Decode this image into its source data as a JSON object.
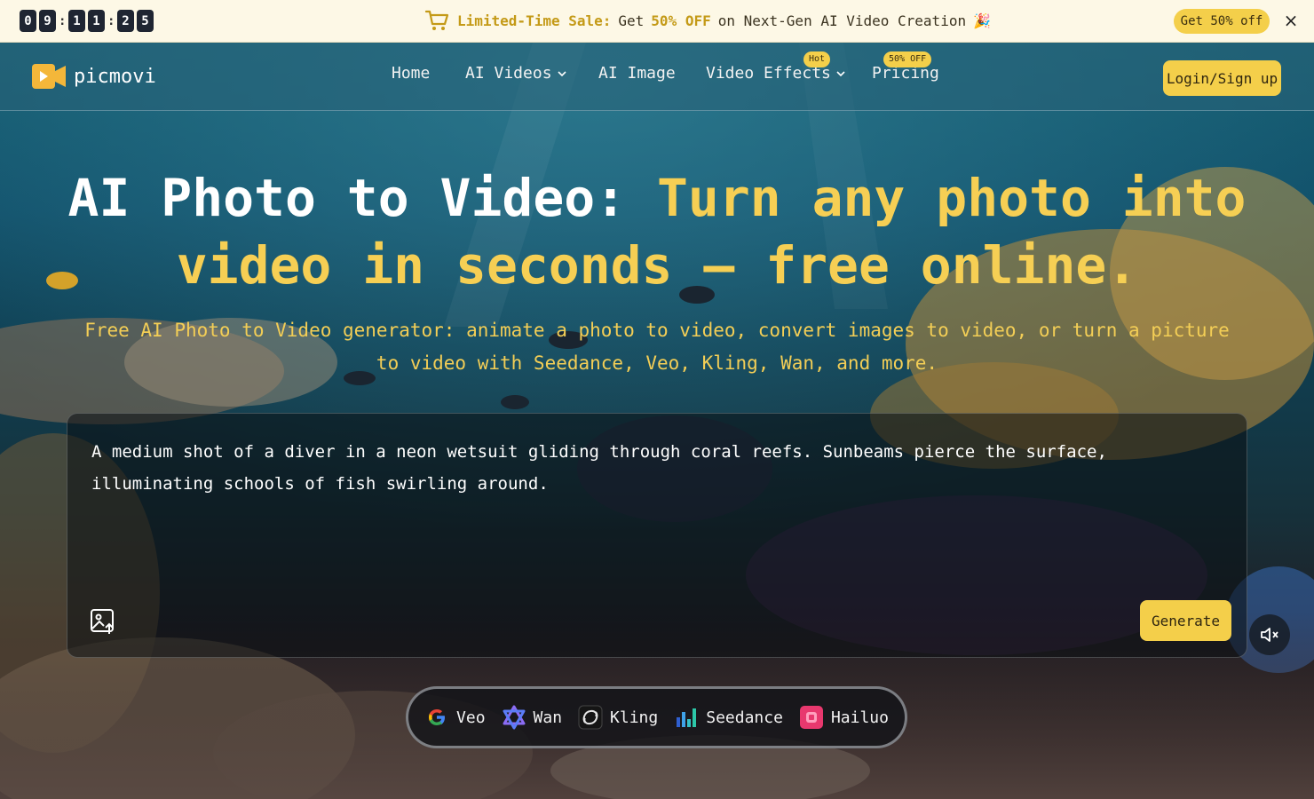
{
  "promo": {
    "countdown": [
      "0",
      "9",
      "1",
      "1",
      "2",
      "5"
    ],
    "lead": "Limited-Time Sale:",
    "pre": "Get",
    "discount": "50% OFF",
    "post": "on Next-Gen AI Video Creation",
    "emoji": "🎉",
    "cta": "Get 50% off",
    "close": "×"
  },
  "nav": {
    "brand": "picmovi",
    "items": [
      {
        "label": "Home"
      },
      {
        "label": "AI Videos",
        "dropdown": true
      },
      {
        "label": "AI Image"
      },
      {
        "label": "Video Effects",
        "dropdown": true,
        "badge": "Hot"
      },
      {
        "label": "Pricing",
        "badge": "50% OFF"
      }
    ],
    "login": "Login/Sign up"
  },
  "hero": {
    "title_white": "AI Photo to Video:",
    "title_accent": "Turn any photo into video in seconds – free online.",
    "subtitle": "Free AI Photo to Video generator: animate a photo to video, convert images to video, or turn a picture to video with Seedance, Veo, Kling, Wan, and more."
  },
  "prompt": {
    "text": "A medium shot of a diver in a neon wetsuit gliding through coral reefs. Sunbeams pierce the surface, illuminating schools of fish swirling around.",
    "generate": "Generate"
  },
  "models": [
    {
      "name": "Veo",
      "icon": "google-icon"
    },
    {
      "name": "Wan",
      "icon": "wan-icon"
    },
    {
      "name": "Kling",
      "icon": "kling-icon"
    },
    {
      "name": "Seedance",
      "icon": "seedance-icon"
    },
    {
      "name": "Hailuo",
      "icon": "hailuo-icon"
    }
  ],
  "colors": {
    "accent": "#f4cf4a",
    "promo_bg": "#fdf8e6",
    "countdown_bg": "#1f2532"
  }
}
